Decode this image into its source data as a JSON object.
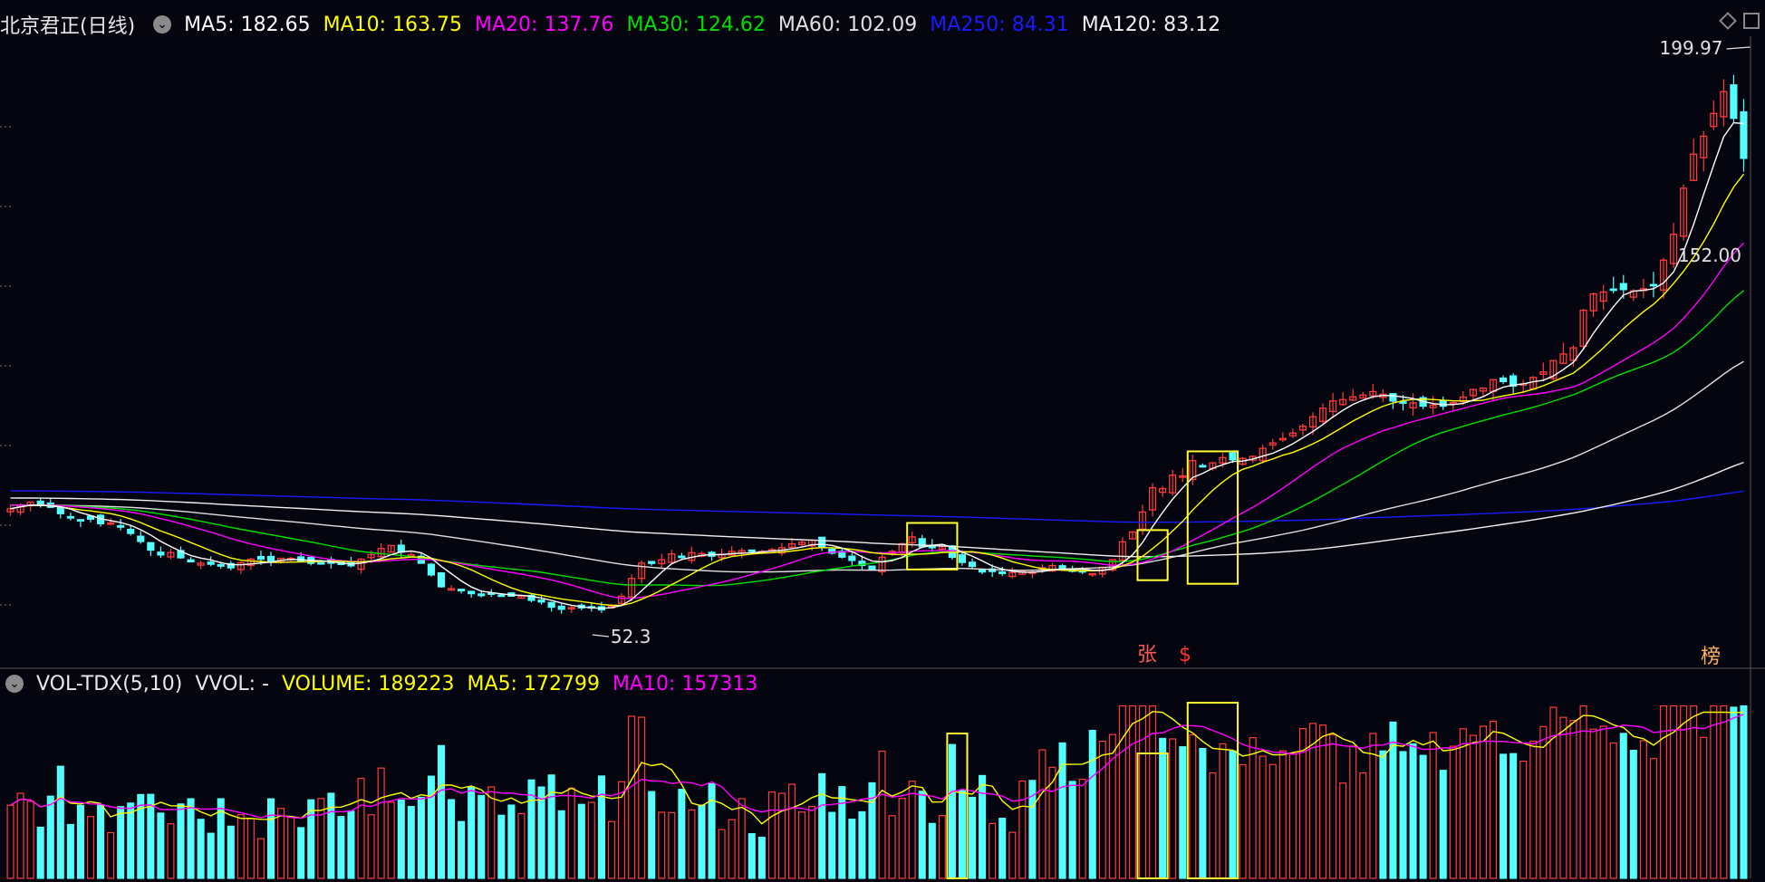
{
  "top_legend": {
    "title": "北京君正(日线)",
    "ma5": "MA5: 182.65",
    "ma10": "MA10: 163.75",
    "ma20": "MA20: 137.76",
    "ma30": "MA30: 124.62",
    "ma60": "MA60: 102.09",
    "ma250": "MA250: 84.31",
    "ma120": "MA120: 83.12"
  },
  "vol_legend": {
    "name": "VOL-TDX(5,10)",
    "vvol": "VVOL: -",
    "volume": "VOLUME: 189223",
    "ma5": "MA5: 172799",
    "ma10": "MA10: 157313"
  },
  "annotations": {
    "high_label": "199.97",
    "low_label": "52.3",
    "right_price": "152.00",
    "marker_zhang": "张",
    "marker_s": "$",
    "marker_bang": "榜"
  },
  "colors": {
    "up": "#ff3b3b",
    "down": "#54ffff",
    "ma5": "#ffffff",
    "ma10": "#ffff00",
    "ma20": "#ff00ff",
    "ma30": "#00e000",
    "ma60": "#e0e0e0",
    "ma250": "#1a1aff",
    "ma120": "#f0f0f0",
    "box": "#ffff33",
    "background": "#05050f"
  },
  "chart_data": {
    "type": "candlestick",
    "price_range": [
      48,
      215
    ],
    "close": [
      82.97,
      84.02,
      84.85,
      83.85,
      83.37,
      81.59,
      80.69,
      79.75,
      80.05,
      78.79,
      79.02,
      77.82,
      76.07,
      73.82,
      71.4,
      70.06,
      70.73,
      69.26,
      68.14,
      67.75,
      67.46,
      66.93,
      66.46,
      67.9,
      68.86,
      68.88,
      68.06,
      69.12,
      69.12,
      68.43,
      67.71,
      67.82,
      67.75,
      67.39,
      67.02,
      68.89,
      70.14,
      71.85,
      72.7,
      70.88,
      70.16,
      67.74,
      64.47,
      61.16,
      60.64,
      60.03,
      59.24,
      58.68,
      59.26,
      58.76,
      58.53,
      58.56,
      57.37,
      56.9,
      55.45,
      54.88,
      55.36,
      55.27,
      55.5,
      54.72,
      55.74,
      58.51,
      63.49,
      67.76,
      67.68,
      68.7,
      70.35,
      69.55,
      70.7,
      70.44,
      69.71,
      70.25,
      71.03,
      71.26,
      71.07,
      71.05,
      71.53,
      72.05,
      73.15,
      73.61,
      74.21,
      72.11,
      70.56,
      69.45,
      68.52,
      67.12,
      66.09,
      69.43,
      71.08,
      73.2,
      75.1,
      72.32,
      72.06,
      72.42,
      69.39,
      67.96,
      66.86,
      65.3,
      65.42,
      64.86,
      65.14,
      65.41,
      65.28,
      66.47,
      67.07,
      66.05,
      65.48,
      65.54,
      64.85,
      66.64,
      68.73,
      73.72,
      76.47,
      82.05,
      88.85,
      88.6,
      92.34,
      92.14,
      96.44,
      94.72,
      95.78,
      97.26,
      96.62,
      97.04,
      97.59,
      99.84,
      101.35,
      102.62,
      104.11,
      106.05,
      108.68,
      111.06,
      113.09,
      113.47,
      114.25,
      114.71,
      115.72,
      114.94,
      113.07,
      112.56,
      112.54,
      111.62,
      111.93,
      111.63,
      112.64,
      114.16,
      116.27,
      116.66,
      119.04,
      118.5,
      117.22,
      117.85,
      119.66,
      121.18,
      124.37,
      126.21,
      127.94,
      138.41,
      143.01,
      143.53,
      144.22,
      144.2,
      143.86,
      144.45,
      145.27,
      152.42,
      159.66,
      172.52,
      182.06,
      187.08,
      193.41,
      199.51,
      192.07,
      180.88
    ],
    "markers_x_index": {
      "high": 174,
      "low": 59
    }
  }
}
